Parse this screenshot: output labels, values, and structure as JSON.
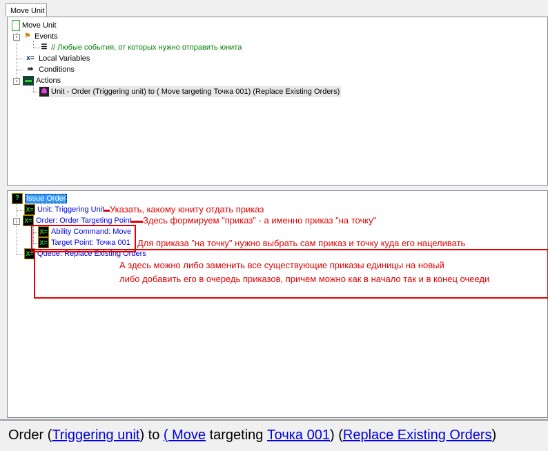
{
  "tab": "Move Unit",
  "tree": {
    "root": "Move Unit",
    "events": "Events",
    "event_comment": "// Любые события, от которых нужно отправить юнита",
    "local_variables": "Local Variables",
    "conditions": "Conditions",
    "actions": "Actions",
    "action_item": "Unit - Order (Triggering unit) to ( Move targeting Точка 001) (Replace Existing Orders)"
  },
  "params": {
    "root": "Issue Order",
    "unit": "Unit: Triggering Unit",
    "order": "Order: Order Targeting Point",
    "ability": "Ability Command:  Move",
    "target": "Target Point: Точка 001",
    "queue": "Queue: Replace Existing Orders"
  },
  "annotations": {
    "unit": "Указать, какому юниту отдать приказ",
    "order": "Здесь формируем \"приказ\" - а именно приказ \"на точку\"",
    "point": "Для приказа \"на точку\" нужно выбрать сам приказ и точку куда его нацеливать",
    "queue_line1": "А здесь можно либо заменить все существующие приказы единицы на новый",
    "queue_line2": "либо добавить его в очередь приказов, причем можно как в начало так и в конец очееди"
  },
  "summary": {
    "p1": "Order (",
    "l1": "Triggering unit",
    "p2": ") to ",
    "l2": "( Move",
    "p3": " targeting ",
    "l3": "Точка 001",
    "p4": ") (",
    "l4": "Replace Existing Orders",
    "p5": ")"
  },
  "colors": {
    "link": "#0000e0",
    "annotation": "#e00000",
    "comment": "#008000"
  }
}
